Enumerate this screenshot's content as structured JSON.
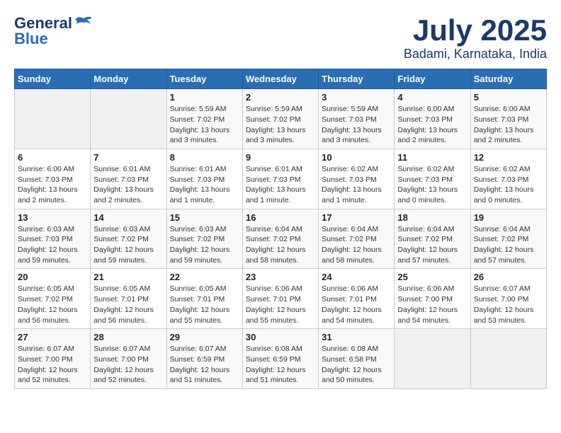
{
  "header": {
    "logo_general": "General",
    "logo_blue": "Blue",
    "title": "July 2025",
    "subtitle": "Badami, Karnataka, India"
  },
  "calendar": {
    "weekdays": [
      "Sunday",
      "Monday",
      "Tuesday",
      "Wednesday",
      "Thursday",
      "Friday",
      "Saturday"
    ],
    "weeks": [
      [
        {
          "day": "",
          "info": ""
        },
        {
          "day": "",
          "info": ""
        },
        {
          "day": "1",
          "info": "Sunrise: 5:59 AM\nSunset: 7:02 PM\nDaylight: 13 hours and 3 minutes."
        },
        {
          "day": "2",
          "info": "Sunrise: 5:59 AM\nSunset: 7:02 PM\nDaylight: 13 hours and 3 minutes."
        },
        {
          "day": "3",
          "info": "Sunrise: 5:59 AM\nSunset: 7:03 PM\nDaylight: 13 hours and 3 minutes."
        },
        {
          "day": "4",
          "info": "Sunrise: 6:00 AM\nSunset: 7:03 PM\nDaylight: 13 hours and 2 minutes."
        },
        {
          "day": "5",
          "info": "Sunrise: 6:00 AM\nSunset: 7:03 PM\nDaylight: 13 hours and 2 minutes."
        }
      ],
      [
        {
          "day": "6",
          "info": "Sunrise: 6:00 AM\nSunset: 7:03 PM\nDaylight: 13 hours and 2 minutes."
        },
        {
          "day": "7",
          "info": "Sunrise: 6:01 AM\nSunset: 7:03 PM\nDaylight: 13 hours and 2 minutes."
        },
        {
          "day": "8",
          "info": "Sunrise: 6:01 AM\nSunset: 7:03 PM\nDaylight: 13 hours and 1 minute."
        },
        {
          "day": "9",
          "info": "Sunrise: 6:01 AM\nSunset: 7:03 PM\nDaylight: 13 hours and 1 minute."
        },
        {
          "day": "10",
          "info": "Sunrise: 6:02 AM\nSunset: 7:03 PM\nDaylight: 13 hours and 1 minute."
        },
        {
          "day": "11",
          "info": "Sunrise: 6:02 AM\nSunset: 7:03 PM\nDaylight: 13 hours and 0 minutes."
        },
        {
          "day": "12",
          "info": "Sunrise: 6:02 AM\nSunset: 7:03 PM\nDaylight: 13 hours and 0 minutes."
        }
      ],
      [
        {
          "day": "13",
          "info": "Sunrise: 6:03 AM\nSunset: 7:03 PM\nDaylight: 12 hours and 59 minutes."
        },
        {
          "day": "14",
          "info": "Sunrise: 6:03 AM\nSunset: 7:02 PM\nDaylight: 12 hours and 59 minutes."
        },
        {
          "day": "15",
          "info": "Sunrise: 6:03 AM\nSunset: 7:02 PM\nDaylight: 12 hours and 59 minutes."
        },
        {
          "day": "16",
          "info": "Sunrise: 6:04 AM\nSunset: 7:02 PM\nDaylight: 12 hours and 58 minutes."
        },
        {
          "day": "17",
          "info": "Sunrise: 6:04 AM\nSunset: 7:02 PM\nDaylight: 12 hours and 58 minutes."
        },
        {
          "day": "18",
          "info": "Sunrise: 6:04 AM\nSunset: 7:02 PM\nDaylight: 12 hours and 57 minutes."
        },
        {
          "day": "19",
          "info": "Sunrise: 6:04 AM\nSunset: 7:02 PM\nDaylight: 12 hours and 57 minutes."
        }
      ],
      [
        {
          "day": "20",
          "info": "Sunrise: 6:05 AM\nSunset: 7:02 PM\nDaylight: 12 hours and 56 minutes."
        },
        {
          "day": "21",
          "info": "Sunrise: 6:05 AM\nSunset: 7:01 PM\nDaylight: 12 hours and 56 minutes."
        },
        {
          "day": "22",
          "info": "Sunrise: 6:05 AM\nSunset: 7:01 PM\nDaylight: 12 hours and 55 minutes."
        },
        {
          "day": "23",
          "info": "Sunrise: 6:06 AM\nSunset: 7:01 PM\nDaylight: 12 hours and 55 minutes."
        },
        {
          "day": "24",
          "info": "Sunrise: 6:06 AM\nSunset: 7:01 PM\nDaylight: 12 hours and 54 minutes."
        },
        {
          "day": "25",
          "info": "Sunrise: 6:06 AM\nSunset: 7:00 PM\nDaylight: 12 hours and 54 minutes."
        },
        {
          "day": "26",
          "info": "Sunrise: 6:07 AM\nSunset: 7:00 PM\nDaylight: 12 hours and 53 minutes."
        }
      ],
      [
        {
          "day": "27",
          "info": "Sunrise: 6:07 AM\nSunset: 7:00 PM\nDaylight: 12 hours and 52 minutes."
        },
        {
          "day": "28",
          "info": "Sunrise: 6:07 AM\nSunset: 7:00 PM\nDaylight: 12 hours and 52 minutes."
        },
        {
          "day": "29",
          "info": "Sunrise: 6:07 AM\nSunset: 6:59 PM\nDaylight: 12 hours and 51 minutes."
        },
        {
          "day": "30",
          "info": "Sunrise: 6:08 AM\nSunset: 6:59 PM\nDaylight: 12 hours and 51 minutes."
        },
        {
          "day": "31",
          "info": "Sunrise: 6:08 AM\nSunset: 6:58 PM\nDaylight: 12 hours and 50 minutes."
        },
        {
          "day": "",
          "info": ""
        },
        {
          "day": "",
          "info": ""
        }
      ]
    ]
  }
}
